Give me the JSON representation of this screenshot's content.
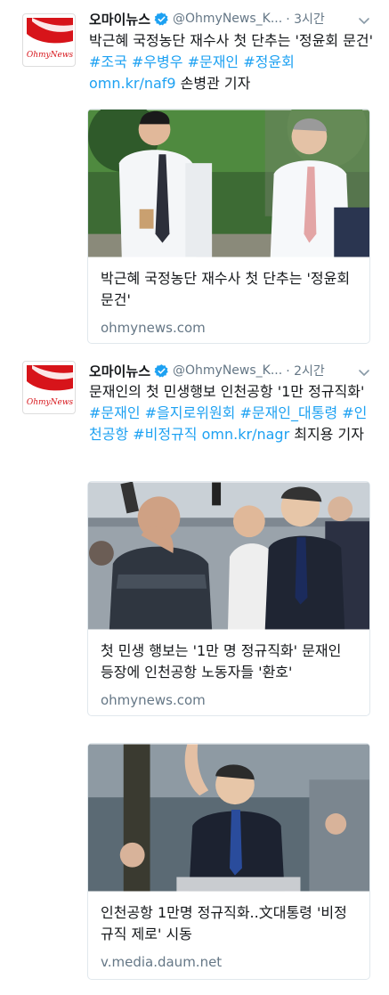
{
  "tweets": [
    {
      "name": "오마이뉴스",
      "handle": "@OhmyNews_K...",
      "time": "· 3시간",
      "text_plain_1": "박근혜 국정농단 재수사 첫 단추는 '정윤회 문건' ",
      "hashtags": "#조국 #우병우 #문재인 #정윤회",
      "link": "omn.kr/naf9",
      "text_plain_2": " 손병관 기자",
      "card": {
        "title": "박근혜 국정농단 재수사 첫 단추는 '정윤회 문건'",
        "domain": "ohmynews.com"
      }
    },
    {
      "name": "오마이뉴스",
      "handle": "@OhmyNews_K...",
      "time": "· 2시간",
      "text_plain_1": "문재인의 첫 민생행보 인천공항 '1만 정규직화' ",
      "hashtags": "#문재인 #을지로위원회 #문재인_대통령 #인천공항 #비정규직",
      "link": "omn.kr/nagr",
      "text_plain_2": " 최지용 기자",
      "card": {
        "title": "첫 민생 행보는 '1만 명 정규직화' 문재인 등장에 인천공항 노동자들 '환호'",
        "domain": "ohmynews.com"
      }
    }
  ],
  "extra_card": {
    "title": "인천공항 1만명 정규직화..文대통령 '비정규직 제로' 시동",
    "domain": "v.media.daum.net"
  },
  "logo_text": "OhmyNews",
  "colors": {
    "link": "#1da1f2",
    "verified": "#1da1f2",
    "logo_red": "#d7141a",
    "secondary": "#657786"
  }
}
